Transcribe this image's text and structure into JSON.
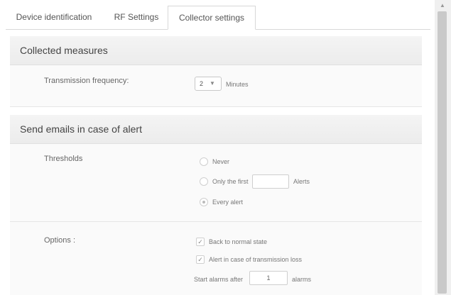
{
  "tabs": [
    {
      "label": "Device identification"
    },
    {
      "label": "RF Settings"
    },
    {
      "label": "Collector settings"
    }
  ],
  "collected": {
    "title": "Collected measures",
    "freq_label": "Transmission frequency:",
    "freq_value": "2",
    "freq_unit": "Minutes"
  },
  "alerts": {
    "title": "Send emails in case of alert",
    "thresholds_label": "Thresholds",
    "radio_never": "Never",
    "radio_first": "Only the first",
    "radio_first_suffix": "Alerts",
    "radio_every": "Every alert",
    "selected_threshold": "Every alert",
    "options_label": "Options :",
    "opt_back": "Back to normal state",
    "opt_loss": "Alert in case of transmission loss",
    "start_prefix": "Start alarms after",
    "start_value": "1",
    "start_suffix": "alarms"
  },
  "icons": {
    "dropdown": "chevron-down-icon",
    "check": "check-icon",
    "scroll_up": "chevron-up-icon"
  }
}
